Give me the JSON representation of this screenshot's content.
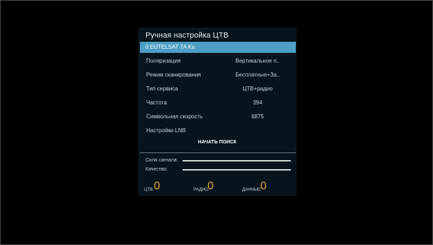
{
  "panel": {
    "title": "Ручная настройка ЦТВ"
  },
  "satellite": {
    "name": "0 EUTELSAT 7A Ku"
  },
  "settings": [
    {
      "label": "Поляризация",
      "value": "Вертикальное п.."
    },
    {
      "label": "Режим сканирования",
      "value": "Бесплатные+За.."
    },
    {
      "label": "Тип сервиса",
      "value": "ЦТВ+радио"
    },
    {
      "label": "Частота",
      "value": "394"
    },
    {
      "label": "Символьная скорость",
      "value": "6875"
    },
    {
      "label": "Настройки LNB",
      "value": ""
    }
  ],
  "start_button": {
    "label": "НАЧАТЬ ПОИСК"
  },
  "meters": {
    "signal_label": "Сила сигнала:",
    "quality_label": "Качество:"
  },
  "counts": {
    "tv_label": "ЦТВ:",
    "tv_value": "0",
    "radio_label": "РАДИО:",
    "radio_value": "0",
    "data_label": "ДАННЫЕ:",
    "data_value": "0"
  },
  "colors": {
    "highlight": "#4e9fc5",
    "panel_bg": "#07141d",
    "count_accent": "#f2a23a"
  }
}
